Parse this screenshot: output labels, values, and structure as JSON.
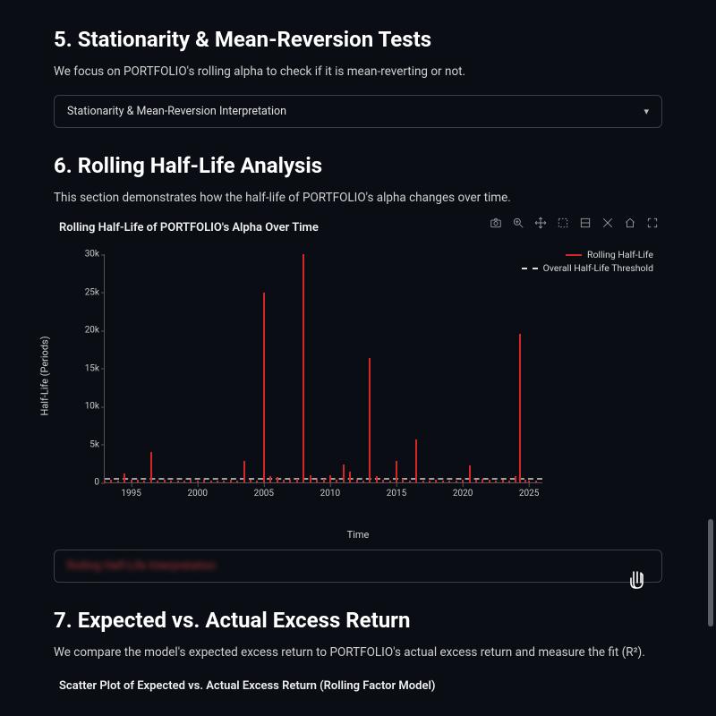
{
  "section5": {
    "heading": "5. Stationarity & Mean-Reversion Tests",
    "desc": "We focus on PORTFOLIO's rolling alpha to check if it is mean-reverting or not.",
    "accordion_label": "Stationarity & Mean-Reversion Interpretation"
  },
  "section6": {
    "heading": "6. Rolling Half-Life Analysis",
    "desc": "This section demonstrates how the half-life of PORTFOLIO's alpha changes over time.",
    "chart_title": "Rolling Half-Life of PORTFOLIO's Alpha Over Time",
    "accordion2_label": "Rolling Half-Life Interpretation"
  },
  "section7": {
    "heading": "7. Expected vs. Actual Excess Return",
    "desc": "We compare the model's expected excess return to PORTFOLIO's actual excess return and measure the fit (R²).",
    "chart_title": "Scatter Plot of Expected vs. Actual Excess Return (Rolling Factor Model)"
  },
  "legend": {
    "series1": "Rolling Half-Life",
    "series2": "Overall Half-Life Threshold"
  },
  "axes": {
    "ylabel": "Half-Life (Periods)",
    "xlabel": "Time"
  },
  "chart_data": {
    "type": "bar",
    "title": "Rolling Half-Life of PORTFOLIO's Alpha Over Time",
    "xlabel": "Time",
    "ylabel": "Half-Life (Periods)",
    "ylim": [
      0,
      30000
    ],
    "xlim": [
      1993,
      2026
    ],
    "yticks": [
      0,
      5000,
      10000,
      15000,
      20000,
      25000,
      30000
    ],
    "ytick_labels": [
      "0",
      "5k",
      "10k",
      "15k",
      "20k",
      "25k",
      "30k"
    ],
    "xticks": [
      1995,
      2000,
      2005,
      2010,
      2015,
      2020,
      2025
    ],
    "threshold": 600,
    "series": [
      {
        "name": "Rolling Half-Life",
        "x": [
          1993,
          1993.5,
          1994,
          1994.5,
          1995,
          1995.5,
          1996,
          1996.5,
          1997,
          1997.5,
          1998,
          1998.5,
          1999,
          1999.5,
          2000,
          2000.5,
          2001,
          2001.5,
          2002,
          2002.5,
          2003,
          2003.5,
          2004,
          2004.5,
          2005,
          2005.5,
          2006,
          2006.5,
          2007,
          2007.5,
          2008,
          2008.5,
          2009,
          2009.5,
          2010,
          2010.5,
          2011,
          2011.5,
          2012,
          2012.5,
          2013,
          2013.5,
          2014,
          2014.5,
          2015,
          2015.5,
          2016,
          2016.5,
          2017,
          2017.5,
          2018,
          2018.5,
          2019,
          2019.5,
          2020,
          2020.5,
          2021,
          2021.5,
          2022,
          2022.5,
          2023,
          2023.5,
          2024,
          2024.3,
          2024.7,
          2025,
          2025.5
        ],
        "values": [
          200,
          300,
          250,
          1200,
          400,
          300,
          200,
          4000,
          250,
          300,
          200,
          250,
          200,
          300,
          250,
          300,
          200,
          250,
          200,
          300,
          250,
          2800,
          400,
          200,
          25000,
          800,
          700,
          300,
          400,
          500,
          30000,
          900,
          400,
          500,
          1000,
          300,
          2300,
          1400,
          400,
          200,
          16300,
          800,
          400,
          200,
          2800,
          500,
          200,
          5600,
          250,
          200,
          300,
          200,
          250,
          200,
          300,
          2200,
          400,
          500,
          400,
          200,
          300,
          200,
          800,
          19500,
          300,
          200,
          250
        ]
      }
    ],
    "legend": [
      "Rolling Half-Life",
      "Overall Half-Life Threshold"
    ]
  }
}
